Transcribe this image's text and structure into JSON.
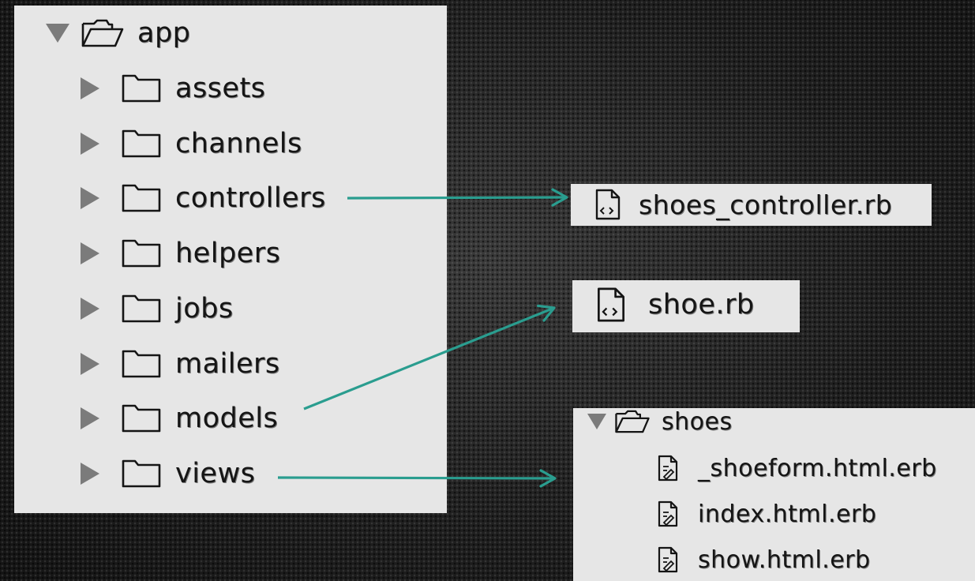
{
  "tree": {
    "root": {
      "label": "app",
      "icon": "open-folder-icon",
      "expander": "expanded-triangle-icon"
    },
    "folders": [
      {
        "label": "assets",
        "icon": "folder-icon"
      },
      {
        "label": "channels",
        "icon": "folder-icon"
      },
      {
        "label": "controllers",
        "icon": "folder-icon"
      },
      {
        "label": "helpers",
        "icon": "folder-icon"
      },
      {
        "label": "jobs",
        "icon": "folder-icon"
      },
      {
        "label": "mailers",
        "icon": "folder-icon"
      },
      {
        "label": "models",
        "icon": "folder-icon"
      },
      {
        "label": "views",
        "icon": "folder-icon"
      }
    ]
  },
  "controllers_panel": {
    "file": "shoes_controller.rb",
    "icon": "code-file-icon"
  },
  "models_panel": {
    "file": "shoe.rb",
    "icon": "code-file-icon"
  },
  "views_panel": {
    "folder": "shoes",
    "files": [
      "_shoeform.html.erb",
      "index.html.erb",
      "show.html.erb"
    ],
    "icon": "template-file-icon"
  },
  "colors": {
    "panel": "#e6e6e6",
    "arrow": "#2a9d8f",
    "text": "#151515",
    "expander": "#7b7b7b"
  },
  "connectors": [
    {
      "from": "controllers",
      "to": "shoes_controller.rb"
    },
    {
      "from": "models",
      "to": "shoe.rb"
    },
    {
      "from": "views",
      "to": "shoes"
    }
  ]
}
